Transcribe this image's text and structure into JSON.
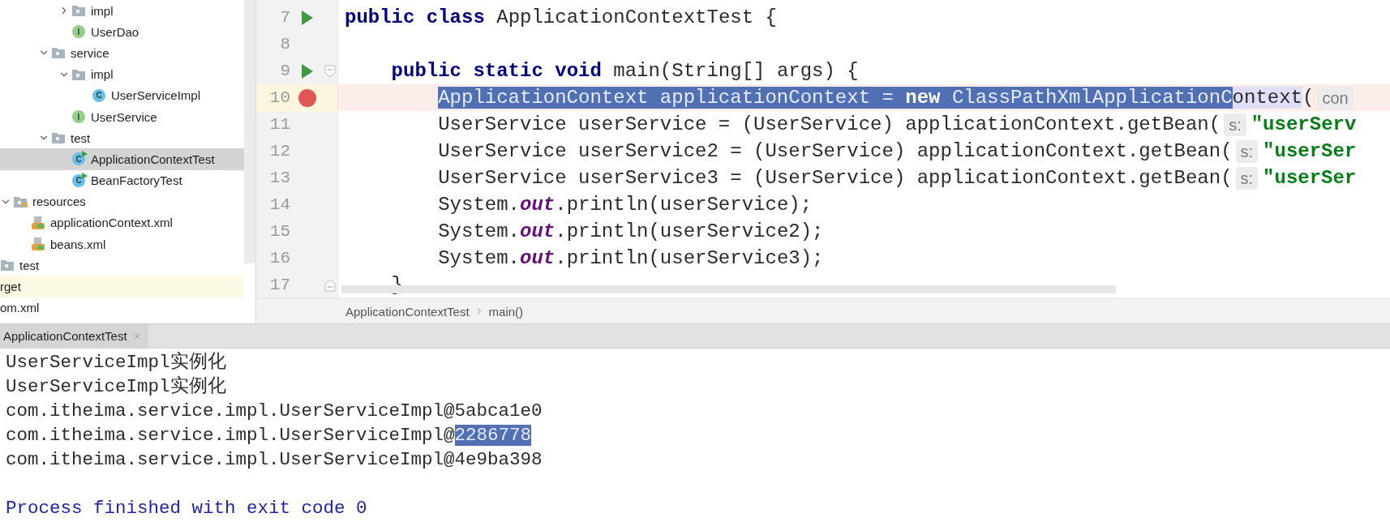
{
  "project_tree": {
    "items": [
      {
        "children": [
          {
            "children": [
              {
                "children": [
                  {
                    "children": [
                      {
                        "label": "impl",
                        "kind": "folder",
                        "expanded": false,
                        "selected": false
                      },
                      {
                        "label": "UserDao",
                        "kind": "interface",
                        "badge": "I",
                        "selected": false
                      }
                    ]
                  },
                  {
                    "label": "service",
                    "kind": "folder",
                    "expanded": true,
                    "selected": false,
                    "children": [
                      {
                        "label": "impl",
                        "kind": "folder",
                        "expanded": true,
                        "selected": false,
                        "children": [
                          {
                            "label": "UserServiceImpl",
                            "kind": "class",
                            "badge": "C",
                            "selected": false
                          }
                        ]
                      },
                      {
                        "label": "UserService",
                        "kind": "interface",
                        "badge": "I",
                        "selected": false
                      }
                    ]
                  },
                  {
                    "label": "test",
                    "kind": "folder",
                    "expanded": true,
                    "selected": false,
                    "children": [
                      {
                        "label": "ApplicationContextTest",
                        "kind": "test-class",
                        "badge": "C",
                        "selected": true
                      },
                      {
                        "label": "BeanFactoryTest",
                        "kind": "test-class",
                        "badge": "C",
                        "selected": false
                      }
                    ]
                  }
                ]
              }
            ]
          },
          {
            "label": "resources",
            "kind": "resources-folder",
            "expanded": true,
            "selected": false,
            "children": [
              {
                "label": "applicationContext.xml",
                "kind": "xml-file",
                "selected": false
              },
              {
                "label": "beans.xml",
                "kind": "xml-file",
                "selected": false
              }
            ]
          }
        ]
      },
      {
        "label": "test",
        "kind": "folder",
        "selected": false,
        "highlighted": false
      },
      {
        "label": "rget",
        "kind": "fragment",
        "selected": false,
        "highlighted": true
      },
      {
        "label": "om.xml",
        "kind": "fragment",
        "selected": false,
        "highlighted": false
      }
    ]
  },
  "editor": {
    "lines": [
      {
        "number": "7",
        "runnable": true,
        "breakpoint": false,
        "fold_start": false,
        "fold_end": false,
        "tokens": [
          {
            "text": "public class",
            "kind": "keyword"
          },
          {
            "text": " ApplicationContextTest {",
            "kind": "plain"
          }
        ],
        "children": [
          {
            "number": "8",
            "runnable": false,
            "breakpoint": false,
            "fold_start": false,
            "fold_end": false
          },
          {
            "number": "9",
            "runnable": true,
            "breakpoint": false,
            "fold_start": true,
            "fold_end": false,
            "tokens": [
              {
                "text": "public static void",
                "kind": "keyword"
              },
              {
                "text": " main(String[] args) {",
                "kind": "plain"
              }
            ],
            "children": [
              {
                "number": "10",
                "runnable": false,
                "breakpoint": true,
                "fold_start": false,
                "fold_end": false,
                "tokens": [
                  {
                    "text": "ApplicationContext applicationContext = ",
                    "kind": "plain",
                    "selected": true
                  },
                  {
                    "text": "new",
                    "kind": "keyword",
                    "selected": true
                  },
                  {
                    "text": " ClassPathXmlApplicationC",
                    "kind": "plain",
                    "selected": true
                  },
                  {
                    "text": "ontext",
                    "kind": "usage",
                    "selected": false
                  },
                  {
                    "text": "(",
                    "kind": "plain",
                    "selected": false
                  },
                  {
                    "text": "con",
                    "kind": "hint"
                  }
                ]
              },
              {
                "number": "11",
                "runnable": false,
                "breakpoint": false,
                "fold_start": false,
                "fold_end": false,
                "tokens": [
                  {
                    "text": "UserService userService = (UserService) applicationContext.getBean(",
                    "kind": "plain"
                  },
                  {
                    "text": "s:",
                    "kind": "hint"
                  },
                  {
                    "text": "\"userServ",
                    "kind": "string"
                  }
                ]
              },
              {
                "number": "12",
                "runnable": false,
                "breakpoint": false,
                "fold_start": false,
                "fold_end": false,
                "tokens": [
                  {
                    "text": "UserService userService2 = (UserService) applicationContext.getBean(",
                    "kind": "plain"
                  },
                  {
                    "text": "s:",
                    "kind": "hint"
                  },
                  {
                    "text": "\"userSer",
                    "kind": "string"
                  }
                ]
              },
              {
                "number": "13",
                "runnable": false,
                "breakpoint": false,
                "fold_start": false,
                "fold_end": false,
                "tokens": [
                  {
                    "text": "UserService userService3 = (UserService) applicationContext.getBean(",
                    "kind": "plain"
                  },
                  {
                    "text": "s:",
                    "kind": "hint"
                  },
                  {
                    "text": "\"userSer",
                    "kind": "string"
                  }
                ]
              },
              {
                "number": "14",
                "runnable": false,
                "breakpoint": false,
                "fold_start": false,
                "fold_end": false,
                "tokens": [
                  {
                    "text": "System.",
                    "kind": "plain"
                  },
                  {
                    "text": "out",
                    "kind": "field"
                  },
                  {
                    "text": ".println(userService);",
                    "kind": "plain"
                  }
                ]
              },
              {
                "number": "15",
                "runnable": false,
                "breakpoint": false,
                "fold_start": false,
                "fold_end": false,
                "tokens": [
                  {
                    "text": "System.",
                    "kind": "plain"
                  },
                  {
                    "text": "out",
                    "kind": "field"
                  },
                  {
                    "text": ".println(userService2);",
                    "kind": "plain"
                  }
                ]
              },
              {
                "number": "16",
                "runnable": false,
                "breakpoint": false,
                "fold_start": false,
                "fold_end": false,
                "tokens": [
                  {
                    "text": "System.",
                    "kind": "plain"
                  },
                  {
                    "text": "out",
                    "kind": "field"
                  },
                  {
                    "text": ".println(userService3);",
                    "kind": "plain"
                  }
                ]
              }
            ]
          },
          {
            "number": "17",
            "runnable": false,
            "breakpoint": false,
            "fold_start": false,
            "fold_end": true,
            "tokens": [
              {
                "text": "}",
                "kind": "plain"
              }
            ]
          }
        ]
      }
    ]
  },
  "breadcrumbs": [
    "ApplicationContextTest",
    "main()"
  ],
  "console": {
    "tab": {
      "label": "ApplicationContextTest",
      "selected": true
    },
    "lines": [
      {
        "kind": "output",
        "segments": [
          {
            "text": "UserServiceImpl实例化",
            "selected": false
          }
        ]
      },
      {
        "kind": "output",
        "segments": [
          {
            "text": "UserServiceImpl实例化",
            "selected": false
          }
        ]
      },
      {
        "kind": "output",
        "segments": [
          {
            "text": "com.itheima.service.impl.UserServiceImpl@5abca1e0",
            "selected": false
          }
        ]
      },
      {
        "kind": "output",
        "segments": [
          {
            "text": "com.itheima.service.impl.UserServiceImpl@",
            "selected": false
          },
          {
            "text": "2286778",
            "selected": true
          }
        ]
      },
      {
        "kind": "output",
        "segments": [
          {
            "text": "com.itheima.service.impl.UserServiceImpl@4e9ba398",
            "selected": false
          }
        ]
      },
      {
        "kind": "system",
        "segments": [
          {
            "text": "Process finished with exit code 0",
            "selected": false
          }
        ]
      }
    ]
  }
}
